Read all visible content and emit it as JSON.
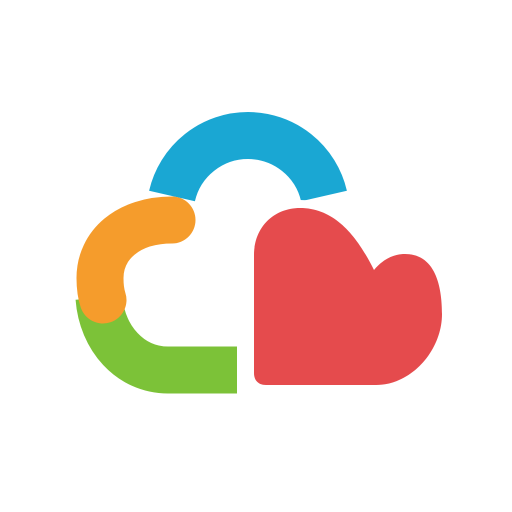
{
  "logo": {
    "name": "cloud-heart-logo",
    "colors": {
      "background": "#ffffff",
      "blue_arc": "#1aa7d3",
      "orange_arc": "#f59c2c",
      "green_arc": "#7cc238",
      "heart": "#e54b4d"
    }
  }
}
